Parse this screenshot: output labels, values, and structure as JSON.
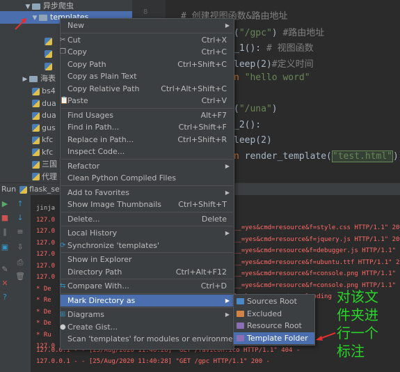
{
  "project_tree": {
    "root_folder": "异步爬虫",
    "selected_folder": "templates",
    "collapsed_folder": "海表",
    "files": [
      "bs4",
      "dua",
      "dua",
      "gus",
      "kfc",
      "kfc",
      "三国",
      "代理"
    ]
  },
  "editor": {
    "lines": [
      {
        "segments": [
          {
            "t": "# 创建视图函数&路由地址",
            "c": "comment"
          }
        ]
      },
      {
        "segments": [
          {
            "t": "(",
            "c": ""
          },
          {
            "t": "\"/gpc\"",
            "c": "str"
          },
          {
            "t": ") ",
            "c": ""
          },
          {
            "t": "#路由地址",
            "c": "comment"
          }
        ]
      },
      {
        "segments": [
          {
            "t": "_1():",
            "c": ""
          },
          {
            "t": " # 视图函数",
            "c": "comment"
          }
        ]
      },
      {
        "segments": [
          {
            "t": "leep(2)",
            "c": ""
          },
          {
            "t": "#定义时间",
            "c": "comment"
          }
        ]
      },
      {
        "segments": [
          {
            "t": "n ",
            "c": "kw"
          },
          {
            "t": "\"hello word\"",
            "c": "str"
          }
        ]
      },
      {
        "segments": [
          {
            "t": "(",
            "c": ""
          },
          {
            "t": "\"/una\"",
            "c": "str"
          },
          {
            "t": ")",
            "c": ""
          }
        ]
      },
      {
        "segments": [
          {
            "t": "_2():",
            "c": ""
          }
        ]
      },
      {
        "segments": [
          {
            "t": "leep(2)",
            "c": ""
          }
        ]
      },
      {
        "segments": [
          {
            "t": "n ",
            "c": "kw"
          },
          {
            "t": "render_template(",
            "c": ""
          },
          {
            "t": "\"test.html\"",
            "c": "str"
          },
          {
            "t": ")",
            "c": ""
          }
        ]
      }
    ]
  },
  "run_panel": {
    "label": "Run",
    "config": "flask_serv",
    "lines": [
      "jinja",
      "127.0",
      "127.0",
      "127.0",
      "127.0",
      "127.0",
      "127.0",
      " * De",
      " * Re",
      " * De",
      " * De",
      " * Ru",
      "127.0",
      "127.0.0.1 - - [25/Aug/2020 11:40:28] \"GET /favicon.ico HTTP/1.1\" 404 -",
      "127.0.0.1 - - [25/Aug/2020 11:40:28] \"GET /gpc HTTP/1.1\" 200 -"
    ],
    "right_lines": [
      "__=yes&cmd=resource&f=style.css HTTP/1.1\" 200 -",
      "__=yes&cmd=resource&f=jquery.js HTTP/1.1\" 200 -",
      "__=yes&cmd=resource&f=debugger.js HTTP/1.1\" 200",
      "__=yes&cmd=resource&f=ubuntu.ttf HTTP/1.1\" 200",
      "__=yes&cmd=resource&f=console.png HTTP/1.1\" 200",
      "__=yes&cmd=resource&f=console.png HTTP/1.1\" 200",
      "lask_server.py', reloading"
    ]
  },
  "context_menu": {
    "items": [
      {
        "label": "New",
        "shortcut": "",
        "submenu": true
      },
      {
        "sep": true
      },
      {
        "label": "Cut",
        "shortcut": "Ctrl+X",
        "icon": "cut-icon"
      },
      {
        "label": "Copy",
        "shortcut": "Ctrl+C",
        "icon": "copy-icon"
      },
      {
        "label": "Copy Path",
        "shortcut": "Ctrl+Shift+C"
      },
      {
        "label": "Copy as Plain Text",
        "shortcut": ""
      },
      {
        "label": "Copy Relative Path",
        "shortcut": "Ctrl+Alt+Shift+C"
      },
      {
        "label": "Paste",
        "shortcut": "Ctrl+V",
        "icon": "paste-icon"
      },
      {
        "sep": true
      },
      {
        "label": "Find Usages",
        "shortcut": "Alt+F7"
      },
      {
        "label": "Find in Path...",
        "shortcut": "Ctrl+Shift+F"
      },
      {
        "label": "Replace in Path...",
        "shortcut": "Ctrl+Shift+R"
      },
      {
        "label": "Inspect Code...",
        "shortcut": ""
      },
      {
        "sep": true
      },
      {
        "label": "Refactor",
        "shortcut": "",
        "submenu": true
      },
      {
        "label": "Clean Python Compiled Files",
        "shortcut": ""
      },
      {
        "sep": true
      },
      {
        "label": "Add to Favorites",
        "shortcut": "",
        "submenu": true
      },
      {
        "label": "Show Image Thumbnails",
        "shortcut": "Ctrl+Shift+T"
      },
      {
        "sep": true
      },
      {
        "label": "Delete...",
        "shortcut": "Delete"
      },
      {
        "sep": true
      },
      {
        "label": "Local History",
        "shortcut": "",
        "submenu": true
      },
      {
        "label": "Synchronize 'templates'",
        "shortcut": "",
        "icon": "sync-icon"
      },
      {
        "sep": true
      },
      {
        "label": "Show in Explorer",
        "shortcut": ""
      },
      {
        "label": "Directory Path",
        "shortcut": "Ctrl+Alt+F12"
      },
      {
        "sep": true
      },
      {
        "label": "Compare With...",
        "shortcut": "Ctrl+D",
        "icon": "compare-icon"
      },
      {
        "sep": true
      },
      {
        "label": "Mark Directory as",
        "shortcut": "",
        "submenu": true,
        "active": true
      },
      {
        "sep": true
      },
      {
        "label": "Diagrams",
        "shortcut": "",
        "submenu": true,
        "icon": "diagram-icon"
      },
      {
        "label": "Create Gist...",
        "shortcut": "",
        "icon": "github-icon"
      },
      {
        "label": "Scan 'templates' for modules or environments",
        "shortcut": ""
      }
    ]
  },
  "submenu": {
    "items": [
      {
        "label": "Sources Root",
        "color": "#4a88c7"
      },
      {
        "label": "Excluded",
        "color": "#d28445"
      },
      {
        "label": "Resource Root",
        "color": "#8b6fb5"
      },
      {
        "label": "Template Folder",
        "color": "#8b6fb5",
        "active": true
      }
    ]
  },
  "annotation": {
    "lines": [
      "对该文",
      "件夹进",
      "行一个",
      "标注"
    ],
    "color": "#2bd42b"
  }
}
